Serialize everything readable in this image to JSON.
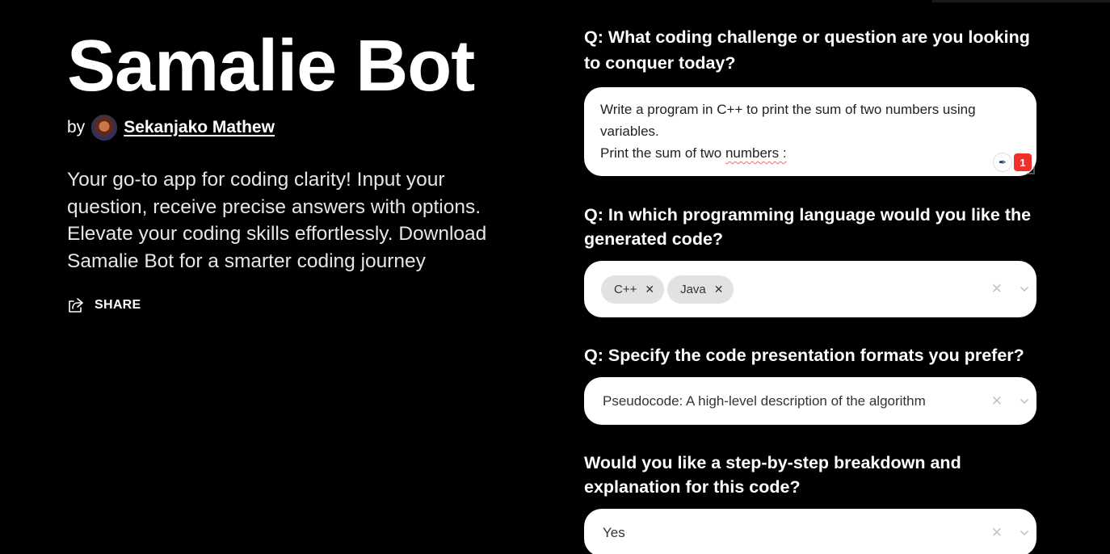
{
  "app": {
    "title": "Samalie Bot",
    "by_label": "by",
    "author": "Sekanjako Mathew",
    "description": "Your go-to app for coding clarity! Input your question, receive precise answers with options. Elevate your coding skills effortlessly. Download Samalie Bot for a smarter coding journey",
    "share_label": "SHARE"
  },
  "form": {
    "q1": {
      "label": "Q: What coding challenge or question are you looking to conquer today?",
      "value_line1": "Write a program in C++ to print the sum of two numbers using variables.",
      "value_line2_prefix": "Print the sum of two ",
      "value_line2_flagged": "numbers :",
      "grammar_issue_count": "1"
    },
    "q2": {
      "label": "Q: In which programming language would you like the generated code?",
      "selected": [
        "C++",
        "Java"
      ]
    },
    "q3": {
      "label": "Q: Specify the code presentation formats you prefer?",
      "value": "Pseudocode: A high-level description of the algorithm"
    },
    "q4": {
      "label": "Would you like a step-by-step breakdown and explanation for this code?",
      "value": "Yes"
    }
  },
  "icons": {
    "share": "share-icon",
    "remove_chip": "close-icon",
    "clear": "clear-icon",
    "dropdown": "chevron-down-icon",
    "grammar": "grammar-checker-icon"
  },
  "colors": {
    "background": "#000000",
    "field_bg": "#ffffff",
    "chip_bg": "#e2e2e2",
    "badge": "#f0312a"
  }
}
